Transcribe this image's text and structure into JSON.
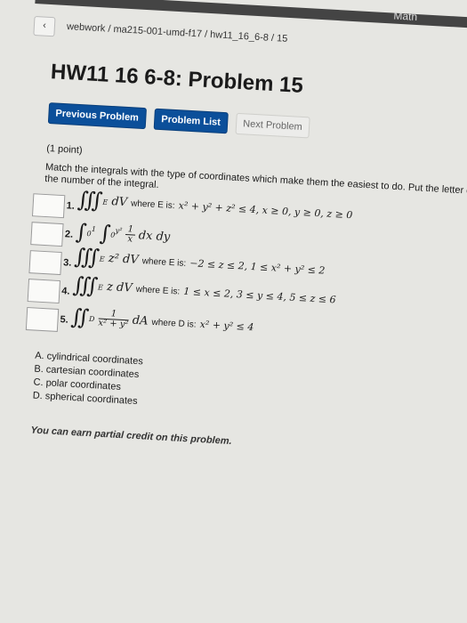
{
  "header": {
    "topband_text": "Math",
    "breadcrumb": "webwork / ma215-001-umd-f17 / hw11_16_6-8 / 15"
  },
  "problem": {
    "title": "HW11 16 6-8: Problem 15",
    "points": "(1 point)",
    "instructions_line1": "Match the integrals with the type of coordinates which make them the easiest to do. Put the letter of the coordinate system to the left of",
    "instructions_line2": "the number of the integral."
  },
  "nav": {
    "previous": "Previous Problem",
    "list": "Problem List",
    "next": "Next Problem"
  },
  "integrals": [
    {
      "number": "1.",
      "expr": "∭E dV",
      "where": "where E is:",
      "cond": "x² + y² + z² ≤ 4, x ≥ 0, y ≥ 0, z ≥ 0",
      "answer": ""
    },
    {
      "number": "2.",
      "expr": "∫0^1 ∫0^y² (1/x) dx dy",
      "where": "",
      "cond": "",
      "answer": ""
    },
    {
      "number": "3.",
      "expr": "∭E z² dV",
      "where": "where E is:",
      "cond": "−2 ≤ z ≤ 2, 1 ≤ x² + y² ≤ 2",
      "answer": ""
    },
    {
      "number": "4.",
      "expr": "∭E z dV",
      "where": "where E is:",
      "cond": "1 ≤ x ≤ 2, 3 ≤ y ≤ 4, 5 ≤ z ≤ 6",
      "answer": ""
    },
    {
      "number": "5.",
      "expr": "∬D 1/(x² + y²) dA",
      "where": "where D is:",
      "cond": "x² + y² ≤ 4",
      "answer": ""
    }
  ],
  "options": [
    "A. cylindrical coordinates",
    "B. cartesian coordinates",
    "C. polar coordinates",
    "D. spherical coordinates"
  ],
  "footer": {
    "credit_text": "You can earn partial credit on this problem."
  }
}
